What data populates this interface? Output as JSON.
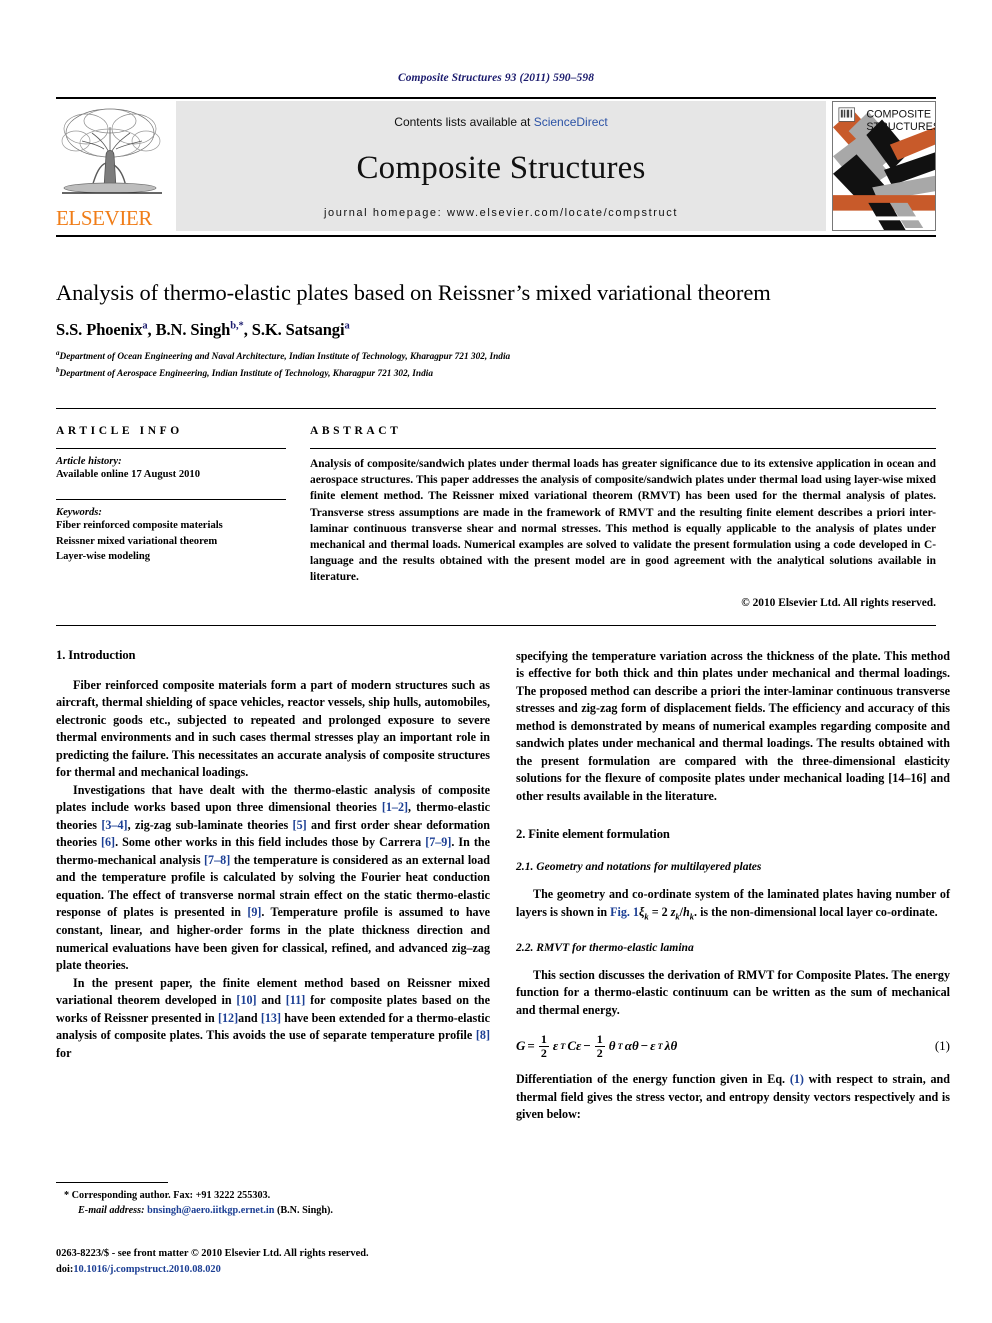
{
  "running_head": "Composite Structures 93 (2011) 590–598",
  "masthead": {
    "publisher_name": "ELSEVIER",
    "contents_prefix": "Contents lists available at ",
    "contents_link": "ScienceDirect",
    "journal_name": "Composite Structures",
    "homepage": "journal homepage: www.elsevier.com/locate/compstruct",
    "cover_title_line1": "COMPOSITE",
    "cover_title_line2": "STRUCTURES"
  },
  "title": "Analysis of thermo-elastic plates based on Reissner’s mixed variational theorem",
  "authors": [
    {
      "name": "S.S. Phoenix",
      "marks": "a",
      "sep": ", "
    },
    {
      "name": "B.N. Singh",
      "marks": "b,*",
      "sep": ", "
    },
    {
      "name": "S.K. Satsangi",
      "marks": "a",
      "sep": ""
    }
  ],
  "affiliations": [
    {
      "mark": "a",
      "text": "Department of Ocean Engineering and Naval Architecture, Indian Institute of Technology, Kharagpur 721 302, India"
    },
    {
      "mark": "b",
      "text": "Department of Aerospace Engineering, Indian Institute of Technology, Kharagpur 721 302, India"
    }
  ],
  "article_info": {
    "heading": "ARTICLE INFO",
    "history_label": "Article history:",
    "history_value": "Available online 17 August 2010",
    "keywords_label": "Keywords:",
    "keywords": [
      "Fiber reinforced composite materials",
      "Reissner mixed variational theorem",
      "Layer-wise modeling"
    ]
  },
  "abstract": {
    "heading": "ABSTRACT",
    "body": "Analysis of composite/sandwich plates under thermal loads has greater significance due to its extensive application in ocean and aerospace structures. This paper addresses the analysis of composite/sandwich plates under thermal load using layer-wise mixed finite element method. The Reissner mixed variational theorem (RMVT) has been used for the thermal analysis of plates. Transverse stress assumptions are made in the framework of RMVT and the resulting finite element describes a priori inter-laminar continuous transverse shear and normal stresses. This method is equally applicable to the analysis of plates under mechanical and thermal loads. Numerical examples are solved to validate the present formulation using a code developed in C-language and the results obtained with the present model are in good agreement with the analytical solutions available in literature.",
    "copyright": "© 2010 Elsevier Ltd. All rights reserved."
  },
  "left_column": {
    "section_heading": "1. Introduction",
    "paragraphs": [
      "Fiber reinforced composite materials form a part of modern structures such as aircraft, thermal shielding of space vehicles, reactor vessels, ship hulls, automobiles, electronic goods etc., subjected to repeated and prolonged exposure to severe thermal environments and in such cases thermal stresses play an important role in predicting the failure. This necessitates an accurate analysis of composite structures for thermal and mechanical loadings.",
      "Investigations that have dealt with the thermo-elastic analysis of composite plates include works based upon three dimensional theories [1–2], thermo-elastic theories [3–4], zig-zag sub-laminate theories [5] and first order shear deformation theories [6]. Some other works in this field includes those by Carrera [7–9]. In the thermo-mechanical analysis [7–8] the temperature is considered as an external load and the temperature profile is calculated by solving the Fourier heat conduction equation. The effect of transverse normal strain effect on the static thermo-elastic response of plates is presented in [9]. Temperature profile is assumed to have constant, linear, and higher-order forms in the plate thickness direction and numerical evaluations have been given for classical, refined, and advanced zig–zag plate theories.",
      "In the present paper, the finite element method based on Reissner mixed variational theorem developed in [10] and [11] for composite plates based on the works of Reissner presented in [12]and [13] have been extended for a thermo-elastic analysis of composite plates. This avoids the use of separate temperature profile [8] for"
    ]
  },
  "right_column": {
    "continuation": "specifying the temperature variation across the thickness of the plate. This method is effective for both thick and thin plates under mechanical and thermal loadings. The proposed method can describe a priori the inter-laminar continuous transverse stresses and zig-zag form of displacement fields. The efficiency and accuracy of this method is demonstrated by means of numerical examples regarding composite and sandwich plates under mechanical and thermal loadings. The results obtained with the present formulation are compared with the three-dimensional elasticity solutions for the flexure of composite plates under mechanical loading [14–16] and other results available in the literature.",
    "section_heading": "2. Finite element formulation",
    "subsection_1": "2.1. Geometry and notations for multilayered plates",
    "paragraph_geometry_pre": "The geometry and co-ordinate system of the laminated plates having number of layers is shown in ",
    "fig_ref": "Fig. 1",
    "paragraph_geometry_post": ". is the non-dimensional local layer co-ordinate.",
    "xi_expr": "ξ",
    "xi_sub": "k",
    "xi_eq": " = 2 ",
    "z_sym": "z",
    "z_sub": "k",
    "slash": "/",
    "h_sym": "h",
    "h_sub": "k",
    "subsection_2": "2.2. RMVT for thermo-elastic lamina",
    "paragraph_rmvt": "This section discusses the derivation of RMVT for Composite Plates. The energy function for a thermo-elastic continuum can be written as the sum of mechanical and thermal energy.",
    "equation": {
      "lhs": "G",
      "equals": "=",
      "num1": "1",
      "den1": "2",
      "term1_a": "ε",
      "term1_sup": "T",
      "term1_b": "Cε",
      "minus1": "−",
      "num2": "1",
      "den2": "2",
      "term2_a": "θ",
      "term2_sup": "T",
      "term2_b": "αθ",
      "minus2": "−",
      "term3_a": "ε",
      "term3_sup": "T",
      "term3_b": "λθ",
      "number": "(1)"
    },
    "paragraph_diff_pre": "Differentiation of the energy function given in Eq. ",
    "eq_ref": "(1)",
    "paragraph_diff_post": " with respect to strain, and thermal field gives the stress vector, and entropy density vectors respectively and is given below:"
  },
  "footnote": {
    "star": "*",
    "corresponding": "Corresponding author. Fax: +91 3222 255303.",
    "email_label": "E-mail address:",
    "email": "bnsingh@aero.iitkgp.ernet.in",
    "email_owner": "(B.N. Singh)."
  },
  "issn": {
    "line1": "0263-8223/$ - see front matter © 2010 Elsevier Ltd. All rights reserved.",
    "doi_label": "doi:",
    "doi_value": "10.1016/j.compstruct.2010.08.020"
  },
  "colors": {
    "link": "#1c3f94",
    "running_head": "#1c1c6e",
    "elsevier_orange": "#f07d18",
    "band_gray": "#e6e6e6",
    "cover_orange": "#c85a2a",
    "cover_gray": "#a8a8a8"
  }
}
